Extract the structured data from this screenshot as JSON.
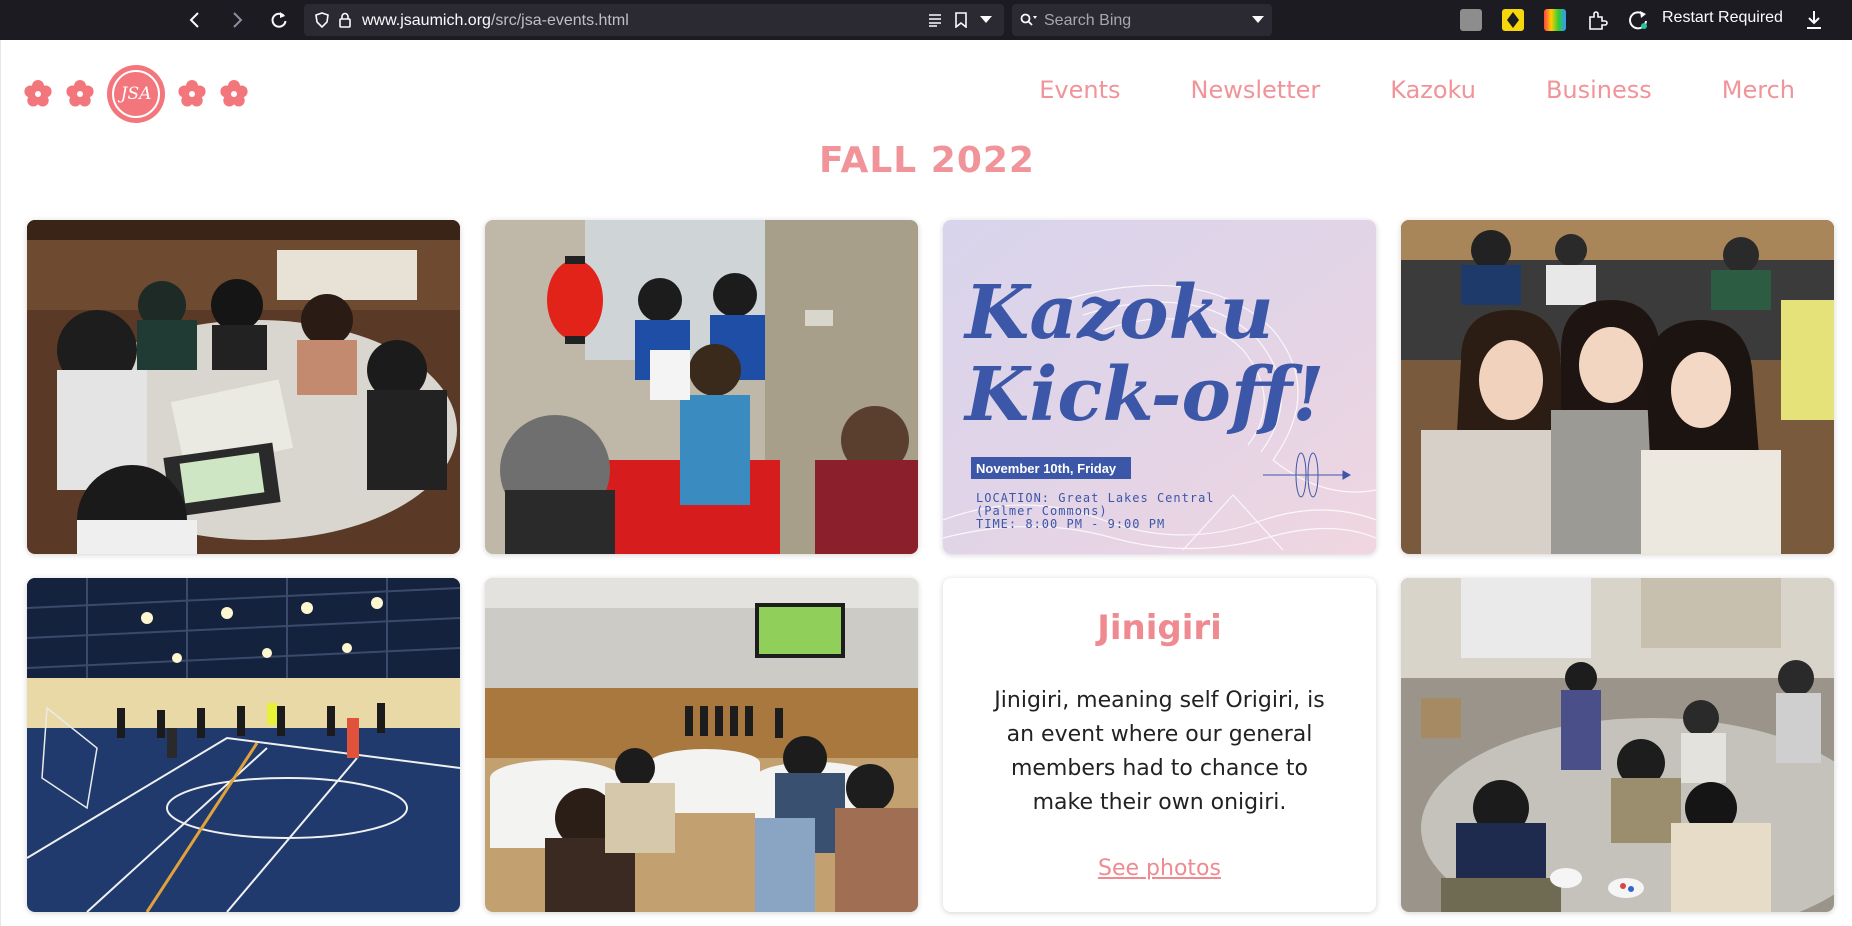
{
  "browser": {
    "url_domain": "www.jsaumich.org",
    "url_path": "/src/jsa-events.html",
    "search_placeholder": "Search Bing",
    "restart_label": "Restart Required"
  },
  "site": {
    "logo_text": "JSA",
    "nav": [
      {
        "label": "Events"
      },
      {
        "label": "Newsletter"
      },
      {
        "label": "Kazoku"
      },
      {
        "label": "Business"
      },
      {
        "label": "Merch"
      }
    ],
    "semester_title": "FALL 2022"
  },
  "kazoku_poster": {
    "title_line1": "Kazoku",
    "title_line2": "Kick-off!",
    "date": "November 10th, Friday",
    "location_line1": "LOCATION: Great Lakes Central",
    "location_line2": "(Palmer Commons)",
    "time": "TIME: 8:00 PM - 9:00 PM"
  },
  "jinigiri_card": {
    "title": "Jinigiri",
    "description": "Jinigiri, meaning self Origiri, is an event where our general members had to chance to make their own onigiri.",
    "link_label": "See photos"
  },
  "colors": {
    "accent_pink": "#f0949a",
    "poster_blue": "#3c57a8",
    "chrome_bg": "#1c1b22"
  }
}
